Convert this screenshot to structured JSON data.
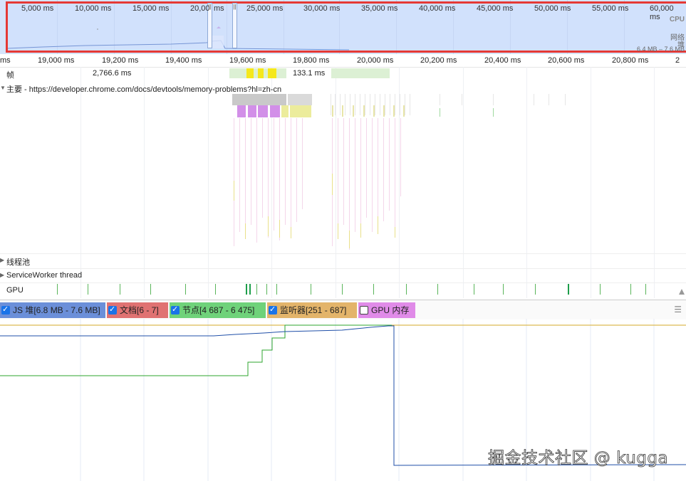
{
  "overview": {
    "ticks": [
      "5,000 ms",
      "10,000 ms",
      "15,000 ms",
      "20,00",
      "ms",
      "25,000 ms",
      "30,000 ms",
      "35,000 ms",
      "40,000 ms",
      "45,000 ms",
      "50,000 ms",
      "55,000 ms",
      "60,000 ms"
    ],
    "right_labels": {
      "cpu": "CPU",
      "net": "网络",
      "heap": "堆",
      "heap_range": "6.4 MB – 7.6 MB"
    },
    "handle_glyph": "||"
  },
  "ruler": {
    "ticks": [
      "ms",
      "19,000 ms",
      "19,200 ms",
      "19,400 ms",
      "19,600 ms",
      "19,800 ms",
      "20,000 ms",
      "20,200 ms",
      "20,400 ms",
      "20,600 ms",
      "20,800 ms",
      "2"
    ]
  },
  "tracks": {
    "frames": {
      "label": "帧",
      "value1": "2,766.6 ms",
      "value2": "133.1 ms"
    },
    "main": {
      "label": "主要 - https://developer.chrome.com/docs/devtools/memory-problems?hl=zh-cn"
    },
    "thread_pool": {
      "label": "线程池"
    },
    "service_worker": {
      "label": "ServiceWorker thread"
    },
    "gpu": {
      "label": "GPU"
    }
  },
  "counters": [
    {
      "label": "JS 堆[6.8 MB - 7.6 MB]",
      "checked": true,
      "color": "#6b8fd9"
    },
    {
      "label": "文档[6 - 7]",
      "checked": true,
      "color": "#e07272"
    },
    {
      "label": "节点[4 687 - 6 475]",
      "checked": true,
      "color": "#6fd27a"
    },
    {
      "label": "监听器[251 - 687]",
      "checked": true,
      "color": "#e3b46a"
    },
    {
      "label": "GPU 内存",
      "checked": false,
      "color": "#e08be8"
    }
  ],
  "watermark": "掘金技术社区 @ kugga",
  "colors": {
    "js_heap": "#1f4fa8",
    "nodes": "#2ea52e",
    "listeners": "#d6a92a",
    "selection": "#e53935"
  }
}
